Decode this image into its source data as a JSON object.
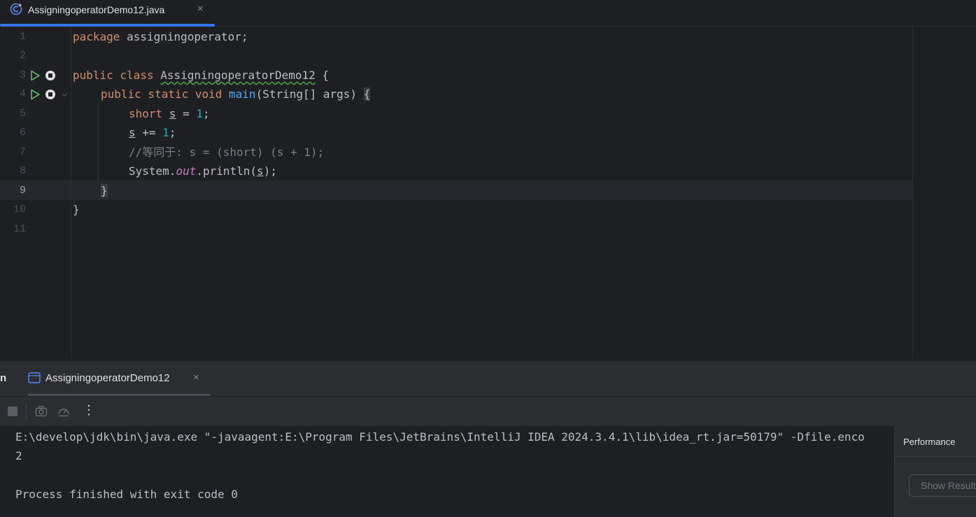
{
  "editor_tab": {
    "title": "AssigningoperatorDemo12.java",
    "close": "×"
  },
  "gutter": {
    "line_numbers": [
      "1",
      "2",
      "3",
      "4",
      "5",
      "6",
      "7",
      "8",
      "9",
      "10",
      "11"
    ]
  },
  "code": {
    "l1": {
      "kw": "package",
      "rest": " assigningoperator;"
    },
    "l3": {
      "kw": "public class",
      "sp": " ",
      "name": "AssigningoperatorDemo12",
      "rest": " {"
    },
    "l4": {
      "kw": "public static void",
      "sp": " ",
      "fn": "main",
      "params": "(String[] args) ",
      "brace": "{"
    },
    "l5": {
      "kw": "short",
      "sp": " ",
      "var": "s",
      "op": " = ",
      "num": "1",
      "end": ";"
    },
    "l6": {
      "var": "s",
      "op": " += ",
      "num": "1",
      "end": ";"
    },
    "l7": {
      "comment": "//等同于: s = (short) (s + 1);"
    },
    "l8": {
      "pre": "System.",
      "field": "out",
      "mid": ".println(",
      "var": "s",
      "end": ");"
    },
    "l9": {
      "brace": "}"
    },
    "l10": {
      "brace": "}"
    }
  },
  "run_window": {
    "label": "n",
    "tab_title": "AssigningoperatorDemo12",
    "tab_close": "×",
    "toolbar": {
      "more": "⋮"
    }
  },
  "console": {
    "lines": [
      "E:\\develop\\jdk\\bin\\java.exe \"-javaagent:E:\\Program Files\\JetBrains\\IntelliJ IDEA 2024.3.4.1\\lib\\idea_rt.jar=50179\" -Dfile.enco",
      "2",
      "",
      "Process finished with exit code 0"
    ]
  },
  "performance_panel": {
    "title": "Performance",
    "button": "Show Results"
  },
  "colors": {
    "accent": "#3574f0",
    "keyword": "#cf8e6d",
    "function": "#56a8f5",
    "number": "#2aacb8",
    "static_field": "#c77dbb",
    "comment": "#7a7e85",
    "run_green": "#5fb865"
  }
}
